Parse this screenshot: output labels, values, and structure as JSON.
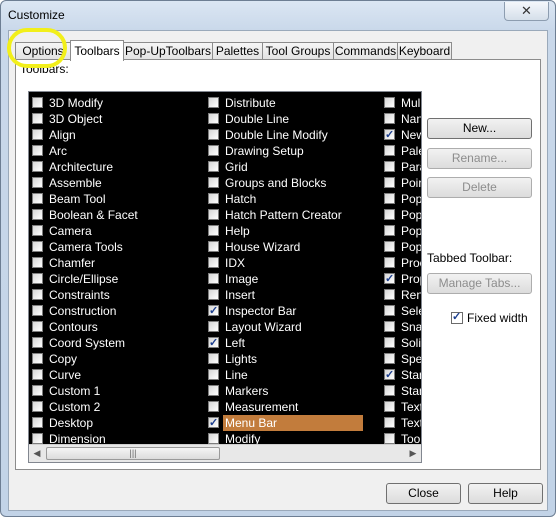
{
  "window": {
    "title": "Customize"
  },
  "tabs": [
    {
      "label": "Options",
      "u": "O",
      "active": false
    },
    {
      "label": "Toolbars",
      "u": "T",
      "active": true
    },
    {
      "label": "Pop-UpToolbars",
      "u": "",
      "active": false
    },
    {
      "label": "Palettes",
      "u": "",
      "active": false
    },
    {
      "label": "Tool Groups",
      "u": "",
      "active": false
    },
    {
      "label": "Commands",
      "u": "C",
      "active": false
    },
    {
      "label": "Keyboard",
      "u": "K",
      "active": false
    }
  ],
  "toolbars_label": "Toolbars:",
  "columns": [
    [
      {
        "label": "3D Modify",
        "checked": false
      },
      {
        "label": "3D Object",
        "checked": false
      },
      {
        "label": "Align",
        "checked": false
      },
      {
        "label": "Arc",
        "checked": false
      },
      {
        "label": "Architecture",
        "checked": false
      },
      {
        "label": "Assemble",
        "checked": false
      },
      {
        "label": "Beam Tool",
        "checked": false
      },
      {
        "label": "Boolean & Facet",
        "checked": false
      },
      {
        "label": "Camera",
        "checked": false
      },
      {
        "label": "Camera Tools",
        "checked": false
      },
      {
        "label": "Chamfer",
        "checked": false
      },
      {
        "label": "Circle/Ellipse",
        "checked": false
      },
      {
        "label": "Constraints",
        "checked": false
      },
      {
        "label": "Construction",
        "checked": false
      },
      {
        "label": "Contours",
        "checked": false
      },
      {
        "label": "Coord System",
        "checked": false
      },
      {
        "label": "Copy",
        "checked": false
      },
      {
        "label": "Curve",
        "checked": false
      },
      {
        "label": "Custom 1",
        "checked": false
      },
      {
        "label": "Custom 2",
        "checked": false
      },
      {
        "label": "Desktop",
        "checked": false
      },
      {
        "label": "Dimension",
        "checked": false
      }
    ],
    [
      {
        "label": "Distribute",
        "checked": false
      },
      {
        "label": "Double Line",
        "checked": false
      },
      {
        "label": "Double Line Modify",
        "checked": false
      },
      {
        "label": "Drawing Setup",
        "checked": false
      },
      {
        "label": "Grid",
        "checked": false
      },
      {
        "label": "Groups and Blocks",
        "checked": false
      },
      {
        "label": "Hatch",
        "checked": false
      },
      {
        "label": "Hatch Pattern Creator",
        "checked": false
      },
      {
        "label": "Help",
        "checked": false
      },
      {
        "label": "House Wizard",
        "checked": false
      },
      {
        "label": "IDX",
        "checked": false
      },
      {
        "label": "Image",
        "checked": false
      },
      {
        "label": "Insert",
        "checked": false
      },
      {
        "label": "Inspector Bar",
        "checked": true
      },
      {
        "label": "Layout Wizard",
        "checked": false
      },
      {
        "label": "Left",
        "checked": true
      },
      {
        "label": "Lights",
        "checked": false
      },
      {
        "label": "Line",
        "checked": false
      },
      {
        "label": "Markers",
        "checked": false
      },
      {
        "label": "Measurement",
        "checked": false
      },
      {
        "label": "Menu Bar",
        "checked": true,
        "selected": true
      },
      {
        "label": "Modify",
        "checked": false
      }
    ],
    [
      {
        "label": "Mul",
        "checked": false
      },
      {
        "label": "Nan",
        "checked": false
      },
      {
        "label": "New",
        "checked": true
      },
      {
        "label": "Pale",
        "checked": false
      },
      {
        "label": "Para",
        "checked": false
      },
      {
        "label": "Poin",
        "checked": false
      },
      {
        "label": "Pop",
        "checked": false
      },
      {
        "label": "Pop",
        "checked": false
      },
      {
        "label": "Pop",
        "checked": false
      },
      {
        "label": "Pop",
        "checked": false
      },
      {
        "label": "Proc",
        "checked": false
      },
      {
        "label": "Prop",
        "checked": true
      },
      {
        "label": "Ren",
        "checked": false
      },
      {
        "label": "Sele",
        "checked": false
      },
      {
        "label": "Snap",
        "checked": false
      },
      {
        "label": "Soli",
        "checked": false
      },
      {
        "label": "Spe",
        "checked": false
      },
      {
        "label": "Stan",
        "checked": true
      },
      {
        "label": "Stan",
        "checked": false
      },
      {
        "label": "Text",
        "checked": false
      },
      {
        "label": "Text",
        "checked": false
      },
      {
        "label": "Too",
        "checked": false
      }
    ]
  ],
  "buttons": {
    "new": "New...",
    "rename": "Rename...",
    "delete": "Delete",
    "manage_tabs": "Manage Tabs...",
    "close": "Close",
    "help": "Help"
  },
  "tabbed_toolbar_label": "Tabbed Toolbar:",
  "fixed_width_label": "Fixed width",
  "fixed_width_checked": true,
  "colors": {
    "highlight": "#f2ef1a",
    "selection": "#c27c3c",
    "list_bg": "#000000"
  }
}
